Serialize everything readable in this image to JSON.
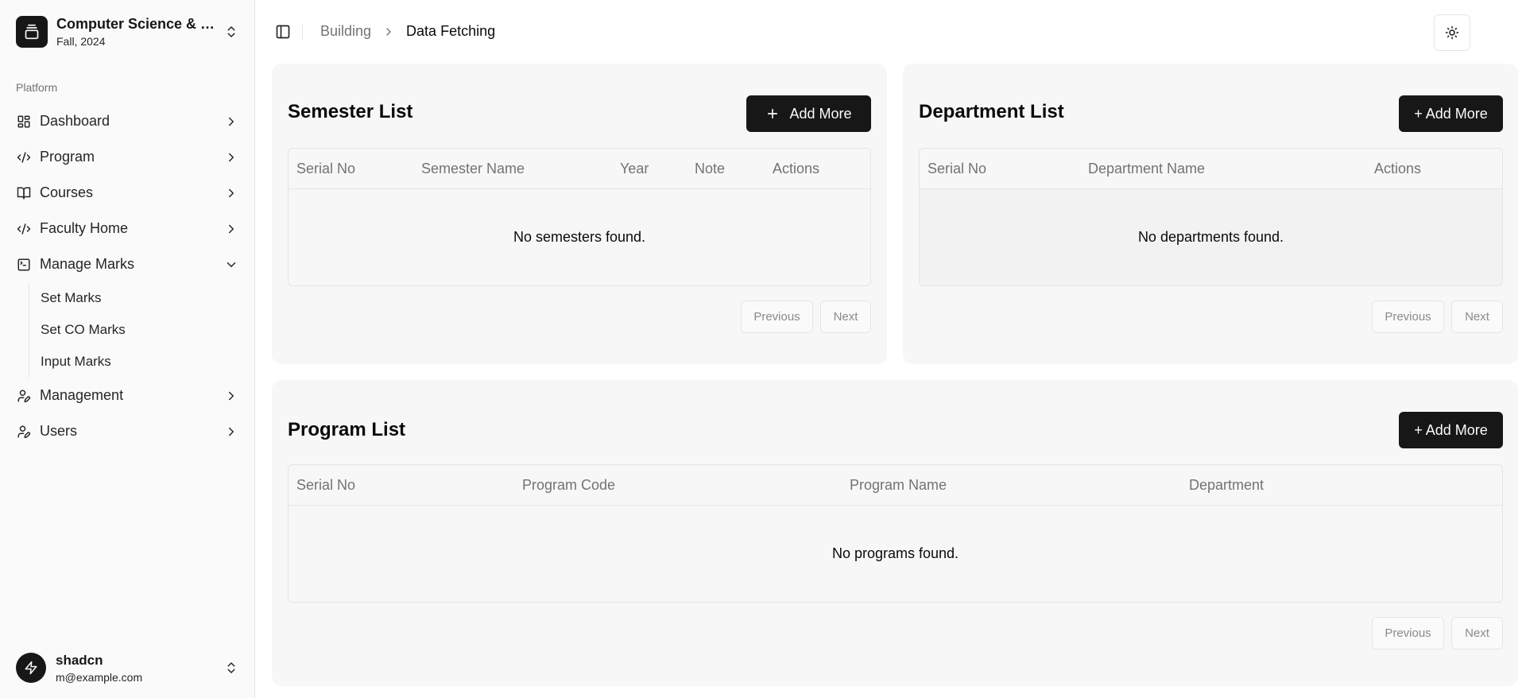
{
  "sidebar": {
    "team": {
      "name": "Computer Science & …",
      "subtitle": "Fall, 2024",
      "logo_icon": "gallery-vertical-end-icon"
    },
    "group_label": "Platform",
    "items": [
      {
        "label": "Dashboard",
        "icon": "layout-dashboard-icon"
      },
      {
        "label": "Program",
        "icon": "code-icon"
      },
      {
        "label": "Courses",
        "icon": "book-open-icon"
      },
      {
        "label": "Faculty Home",
        "icon": "code-icon"
      },
      {
        "label": "Manage Marks",
        "icon": "terminal-square-icon",
        "expanded": true,
        "subitems": [
          "Set Marks",
          "Set CO Marks",
          "Input Marks"
        ]
      },
      {
        "label": "Management",
        "icon": "user-pen-icon"
      },
      {
        "label": "Users",
        "icon": "user-pen-icon"
      }
    ],
    "user": {
      "name": "shadcn",
      "email": "m@example.com",
      "avatar_icon": "zap-icon"
    }
  },
  "header": {
    "breadcrumb": {
      "parent": "Building",
      "current": "Data Fetching"
    },
    "theme_icon": "sun-icon"
  },
  "semester_card": {
    "title": "Semester List",
    "add_label": "Add More",
    "columns": [
      "Serial No",
      "Semester Name",
      "Year",
      "Note",
      "Actions"
    ],
    "empty_text": "No semesters found.",
    "prev_label": "Previous",
    "next_label": "Next"
  },
  "department_card": {
    "title": "Department List",
    "add_label": "+ Add More",
    "columns": [
      "Serial No",
      "Department Name",
      "Actions"
    ],
    "empty_text": "No departments found.",
    "prev_label": "Previous",
    "next_label": "Next"
  },
  "program_card": {
    "title": "Program List",
    "add_label": "+ Add More",
    "columns": [
      "Serial No",
      "Program Code",
      "Program Name",
      "Department"
    ],
    "empty_text": "No programs found.",
    "prev_label": "Previous",
    "next_label": "Next"
  },
  "colors": {
    "primary": "#171717",
    "sidebar_bg": "#fafafa",
    "card_bg": "#f7f7f7",
    "muted_text": "#737373",
    "border": "#e5e5e5"
  }
}
